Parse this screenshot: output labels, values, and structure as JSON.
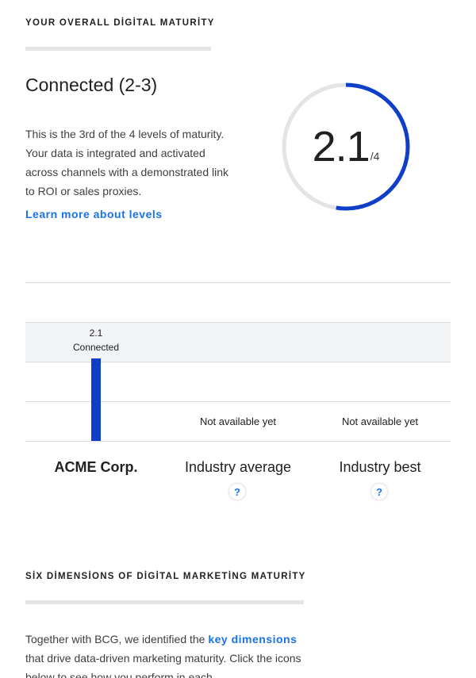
{
  "overall": {
    "eyebrow": "YOUR OVERALL DİGİTAL MATURİTY",
    "level_title": "Connected (2-3)",
    "description": "This is the 3rd of the 4 levels of maturity. Your data is integrated and activated across channels with a demonstrated link to ROI or sales proxies.",
    "learn_more_link": "Learn more about levels",
    "score": "2.1",
    "score_max": "/4",
    "gauge_fill_fraction": 0.525,
    "colors": {
      "accent": "#0f3ec8",
      "track": "#e3e4e6",
      "link": "#1a73e8"
    }
  },
  "comparison": {
    "bars": [
      {
        "category": "ACME Corp.",
        "value_label": "2.1",
        "level_label": "Connected",
        "value": 2.1,
        "available": true,
        "help": ""
      },
      {
        "category": "Industry average",
        "status": "Not available yet",
        "available": false,
        "help": "?"
      },
      {
        "category": "Industry best",
        "status": "Not available yet",
        "available": false,
        "help": "?"
      }
    ],
    "scale_max": 4
  },
  "dimensions": {
    "eyebrow": "SİX DİMENSİONS OF DİGİTAL MARKETİNG MATURİTY",
    "intro_before_link": "Together with BCG, we identified the ",
    "intro_link": "key dimensions",
    "intro_after_link": " that drive data-driven marketing maturity. Click the icons below to see how you perform in each"
  }
}
